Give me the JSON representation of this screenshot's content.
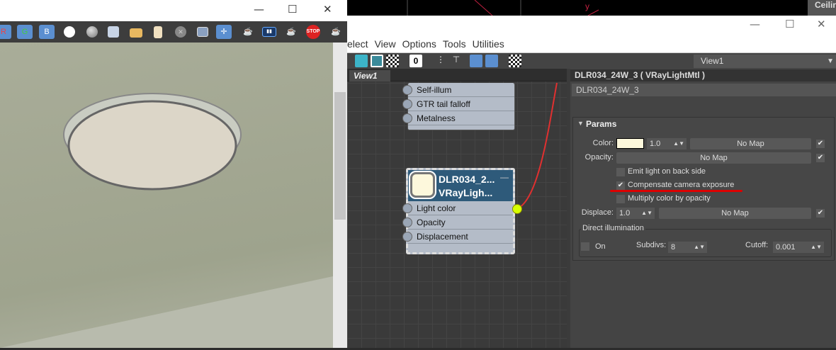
{
  "viewport": {
    "axis_label": "y",
    "side_label": "Ceilin"
  },
  "render_window": {
    "toolbar": [
      {
        "name": "red-channel",
        "label": "R",
        "icon": "red-channel-icon"
      },
      {
        "name": "green-channel",
        "label": "G",
        "icon": "green-channel-icon"
      },
      {
        "name": "blue-channel",
        "label": "B",
        "icon": "blue-channel-icon"
      },
      {
        "name": "white-channel",
        "icon": "white-circle-icon"
      },
      {
        "name": "mono",
        "icon": "gray-circle-icon"
      },
      {
        "name": "save",
        "icon": "save-icon"
      },
      {
        "name": "open",
        "icon": "folder-icon"
      },
      {
        "name": "clipboard",
        "icon": "clipboard-icon"
      },
      {
        "name": "clear",
        "icon": "clear-icon"
      },
      {
        "name": "region",
        "icon": "region-icon"
      },
      {
        "name": "track-mouse",
        "icon": "track-mouse-icon"
      },
      {
        "name": "render-teapot",
        "icon": "teapot-icon"
      },
      {
        "name": "lens-fx",
        "icon": "lens-icon"
      },
      {
        "name": "render-interactive",
        "icon": "teapot-play-icon"
      },
      {
        "name": "stop",
        "label": "STOP",
        "icon": "stop-icon"
      },
      {
        "name": "render-last",
        "icon": "teapot-icon"
      }
    ]
  },
  "slate": {
    "menu": [
      "elect",
      "View",
      "Options",
      "Tools",
      "Utilities"
    ],
    "view_select": "View1",
    "tab": "View1",
    "node_top": {
      "slots": [
        "Self-illum",
        "GTR tail falloff",
        "Metalness"
      ]
    },
    "node_main": {
      "title1": "DLR034_2...",
      "title2": "VRayLigh...",
      "slots": [
        "Light color",
        "Opacity",
        "Displacement"
      ]
    },
    "panel": {
      "header": "DLR034_24W_3  ( VRayLightMtl )",
      "name": "DLR034_24W_3",
      "rollout": "Params",
      "color_label": "Color:",
      "color_swatch": "#fdf8dc",
      "color_mult": "1.0",
      "no_map": "No Map",
      "opacity_label": "Opacity:",
      "emit_back": "Emit light on back side",
      "compensate": "Compensate camera exposure",
      "multiply": "Multiply color by opacity",
      "displace_label": "Displace:",
      "displace_val": "1.0",
      "direct_title": "Direct illumination",
      "on_label": "On",
      "subdivs_label": "Subdivs:",
      "subdivs_val": "8",
      "cutoff_label": "Cutoff:",
      "cutoff_val": "0.001"
    }
  }
}
